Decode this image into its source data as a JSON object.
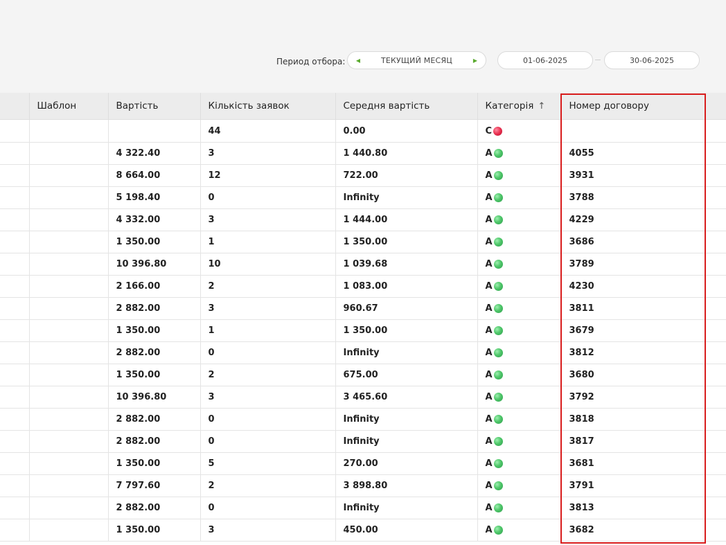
{
  "filter": {
    "label": "Период отбора:",
    "period": "ТЕКУЩИЙ МЕСЯЦ",
    "date_from": "01-06-2025",
    "date_to": "30-06-2025"
  },
  "table": {
    "headers": {
      "template": "Шаблон",
      "cost": "Вартість",
      "orders": "Кількість заявок",
      "avg_cost": "Середня вартість",
      "category": "Категорія",
      "contract": "Номер договору"
    },
    "rows": [
      {
        "cost": "",
        "orders": "44",
        "avg": "0.00",
        "cat": "C",
        "status": "red",
        "contract": ""
      },
      {
        "cost": "4 322.40",
        "orders": "3",
        "avg": "1 440.80",
        "cat": "A",
        "status": "green",
        "contract": "4055"
      },
      {
        "cost": "8 664.00",
        "orders": "12",
        "avg": "722.00",
        "cat": "A",
        "status": "green",
        "contract": "3931"
      },
      {
        "cost": "5 198.40",
        "orders": "0",
        "avg": "Infinity",
        "cat": "A",
        "status": "green",
        "contract": "3788"
      },
      {
        "cost": "4 332.00",
        "orders": "3",
        "avg": "1 444.00",
        "cat": "A",
        "status": "green",
        "contract": "4229"
      },
      {
        "cost": "1 350.00",
        "orders": "1",
        "avg": "1 350.00",
        "cat": "A",
        "status": "green",
        "contract": "3686"
      },
      {
        "cost": "10 396.80",
        "orders": "10",
        "avg": "1 039.68",
        "cat": "A",
        "status": "green",
        "contract": "3789"
      },
      {
        "cost": "2 166.00",
        "orders": "2",
        "avg": "1 083.00",
        "cat": "A",
        "status": "green",
        "contract": "4230"
      },
      {
        "cost": "2 882.00",
        "orders": "3",
        "avg": "960.67",
        "cat": "A",
        "status": "green",
        "contract": "3811"
      },
      {
        "cost": "1 350.00",
        "orders": "1",
        "avg": "1 350.00",
        "cat": "A",
        "status": "green",
        "contract": "3679"
      },
      {
        "cost": "2 882.00",
        "orders": "0",
        "avg": "Infinity",
        "cat": "A",
        "status": "green",
        "contract": "3812"
      },
      {
        "cost": "1 350.00",
        "orders": "2",
        "avg": "675.00",
        "cat": "A",
        "status": "green",
        "contract": "3680"
      },
      {
        "cost": "10 396.80",
        "orders": "3",
        "avg": "3 465.60",
        "cat": "A",
        "status": "green",
        "contract": "3792"
      },
      {
        "cost": "2 882.00",
        "orders": "0",
        "avg": "Infinity",
        "cat": "A",
        "status": "green",
        "contract": "3818"
      },
      {
        "cost": "2 882.00",
        "orders": "0",
        "avg": "Infinity",
        "cat": "A",
        "status": "green",
        "contract": "3817"
      },
      {
        "cost": "1 350.00",
        "orders": "5",
        "avg": "270.00",
        "cat": "A",
        "status": "green",
        "contract": "3681"
      },
      {
        "cost": "7 797.60",
        "orders": "2",
        "avg": "3 898.80",
        "cat": "A",
        "status": "green",
        "contract": "3791"
      },
      {
        "cost": "2 882.00",
        "orders": "0",
        "avg": "Infinity",
        "cat": "A",
        "status": "green",
        "contract": "3813"
      },
      {
        "cost": "1 350.00",
        "orders": "3",
        "avg": "450.00",
        "cat": "A",
        "status": "green",
        "contract": "3682"
      }
    ]
  },
  "colors": {
    "highlight": "#d81c1c",
    "status_green": "#4fc76a",
    "status_red": "#e8304f",
    "accent_arrow": "#5aaa2e"
  }
}
